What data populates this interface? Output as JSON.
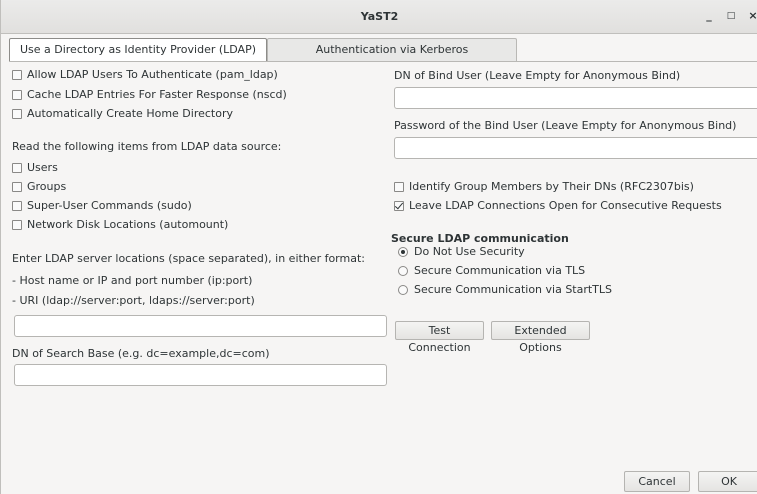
{
  "window": {
    "title": "YaST2",
    "minimize_glyph": "_",
    "maximize_glyph": "□",
    "close_glyph": "×"
  },
  "tabs": [
    {
      "label": "Use a Directory as Identity Provider (LDAP)",
      "active": true
    },
    {
      "label": "Authentication via Kerberos",
      "active": false
    }
  ],
  "left": {
    "options": [
      {
        "label": "Allow LDAP Users To Authenticate (pam_ldap)",
        "checked": false
      },
      {
        "label": "Cache LDAP Entries For Faster Response (nscd)",
        "checked": false
      },
      {
        "label": "Automatically Create Home Directory",
        "checked": false
      }
    ],
    "read_items_heading": "Read the following items from LDAP data source:",
    "items": [
      {
        "label": "Users",
        "checked": false
      },
      {
        "label": "Groups",
        "checked": false
      },
      {
        "label": "Super-User Commands (sudo)",
        "checked": false
      },
      {
        "label": "Network Disk Locations (automount)",
        "checked": false
      }
    ],
    "server_hint": "Enter LDAP server locations (space separated), in either format:",
    "server_format_1": "- Host name or IP and port number (ip:port)",
    "server_format_2": "- URI (ldap://server:port, ldaps://server:port)",
    "server_value": "",
    "search_base_label": "DN of Search Base (e.g. dc=example,dc=com)",
    "search_base_value": ""
  },
  "right": {
    "bind_dn_label": "DN of Bind User (Leave Empty for Anonymous Bind)",
    "bind_dn_value": "",
    "bind_pw_label": "Password of the Bind User (Leave Empty for Anonymous Bind)",
    "bind_pw_value": "",
    "options": [
      {
        "label": "Identify Group Members by Their DNs (RFC2307bis)",
        "checked": false
      },
      {
        "label": "Leave LDAP Connections Open for Consecutive Requests",
        "checked": true
      }
    ],
    "security_heading": "Secure LDAP communication",
    "security_options": [
      {
        "label": "Do Not Use Security",
        "selected": true
      },
      {
        "label": "Secure Communication via TLS",
        "selected": false
      },
      {
        "label": "Secure Communication via StartTLS",
        "selected": false
      }
    ],
    "test_connection_label": "Test Connection",
    "extended_options_label": "Extended Options"
  },
  "footer": {
    "cancel_label": "Cancel",
    "ok_label": "OK"
  }
}
